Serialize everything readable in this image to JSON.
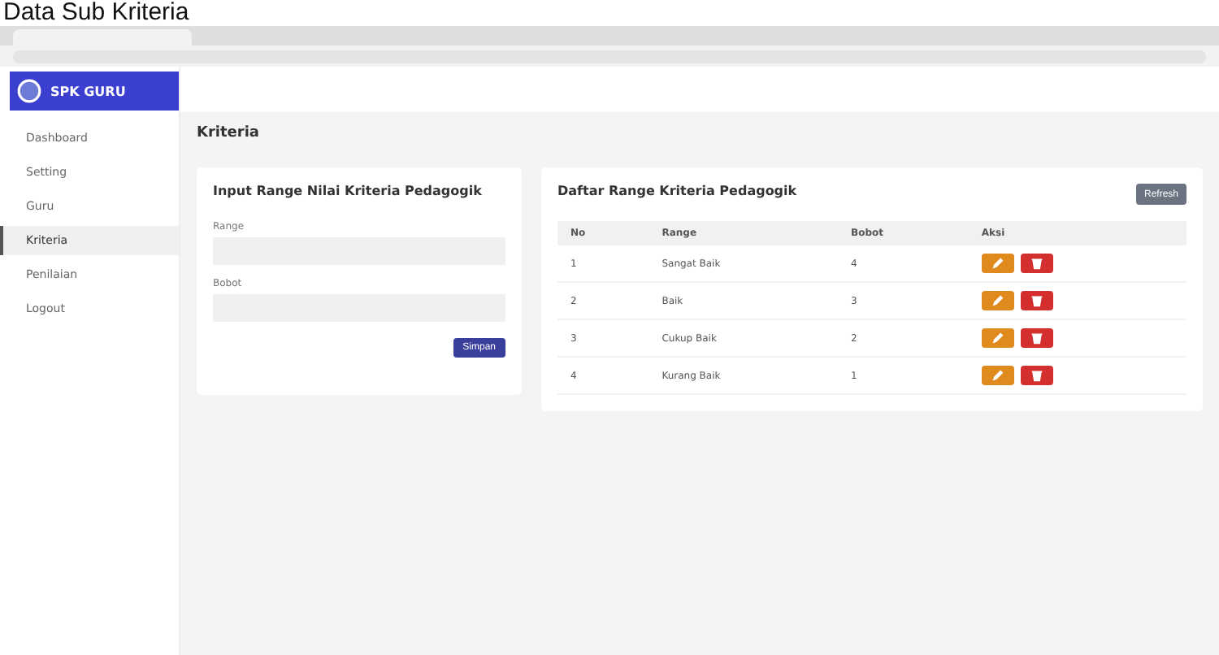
{
  "caption": "Data Sub Kriteria",
  "app": {
    "brand": "SPK GURU"
  },
  "sidebar": {
    "items": [
      {
        "label": "Dashboard",
        "selected": false
      },
      {
        "label": "Setting",
        "selected": false
      },
      {
        "label": "Guru",
        "selected": false
      },
      {
        "label": "Kriteria",
        "selected": true
      },
      {
        "label": "Penilaian",
        "selected": false
      },
      {
        "label": "Logout",
        "selected": false
      }
    ]
  },
  "page_title": "Kriteria",
  "form": {
    "title": "Input Range Nilai Kriteria Pedagogik",
    "fields": [
      {
        "label": "Range"
      },
      {
        "label": "Bobot"
      }
    ],
    "submit": "Simpan"
  },
  "list": {
    "title": "Daftar Range Kriteria Pedagogik",
    "refresh": "Refresh",
    "columns": [
      "No",
      "Range",
      "Bobot",
      "Aksi"
    ],
    "rows": [
      {
        "no": "1",
        "range": "Sangat Baik",
        "bobot": "4"
      },
      {
        "no": "2",
        "range": "Baik",
        "bobot": "3"
      },
      {
        "no": "3",
        "range": "Cukup Baik",
        "bobot": "2"
      },
      {
        "no": "4",
        "range": "Kurang Baik",
        "bobot": "1"
      }
    ]
  }
}
